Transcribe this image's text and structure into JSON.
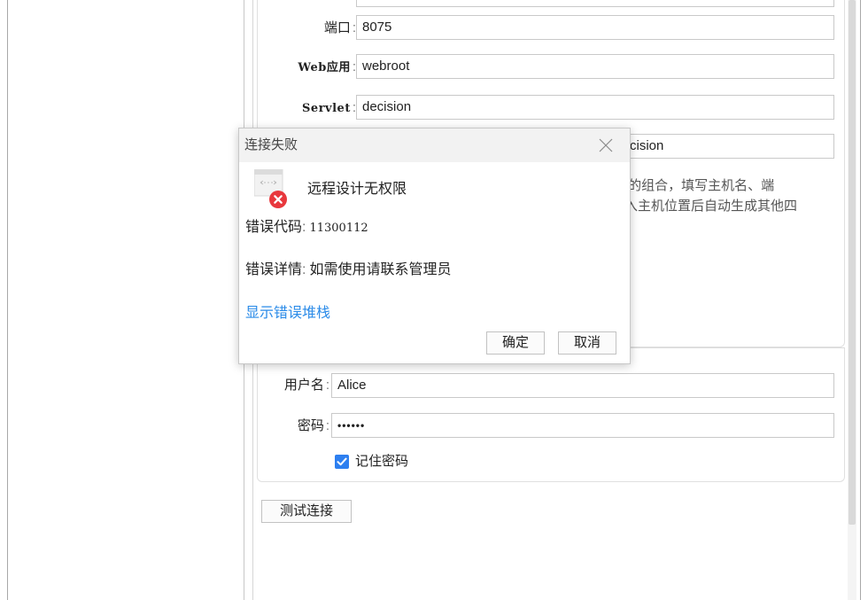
{
  "form": {
    "port": {
      "label": "端口",
      "colon": ":",
      "value": "8075"
    },
    "web_app": {
      "label": "Web应用",
      "colon": ":",
      "value": "webroot"
    },
    "servlet": {
      "label": "Servlet",
      "colon": ":",
      "value": "decision"
    },
    "url_partial_value": "cision",
    "description_line1": "t的组合，填写主机名、端",
    "description_line2": "入主机位置后自动生成其他四",
    "username": {
      "label": "用户名",
      "colon": ":",
      "value": "Alice"
    },
    "password": {
      "label": "密码",
      "colon": ":",
      "value": "••••••"
    },
    "remember_password": {
      "label": "记住密码",
      "checked": true
    },
    "test_connection_label": "测试连接"
  },
  "dialog": {
    "title": "连接失败",
    "message": "远程设计无权限",
    "error_code_label": "错误代码",
    "error_code_colon": ":",
    "error_code_value": "11300112",
    "error_detail_label": "错误详情",
    "error_detail_colon": ":",
    "error_detail_value": "如需使用请联系管理员",
    "show_stack_link": "显示错误堆栈",
    "ok_label": "确定",
    "cancel_label": "取消",
    "icons": {
      "close": "close-icon",
      "error": "error-icon"
    }
  },
  "colors": {
    "accent": "#2d7ff0",
    "link": "#2b8be8",
    "error_red": "#e8383d",
    "dialog_header_bg": "#f2f2f2"
  }
}
